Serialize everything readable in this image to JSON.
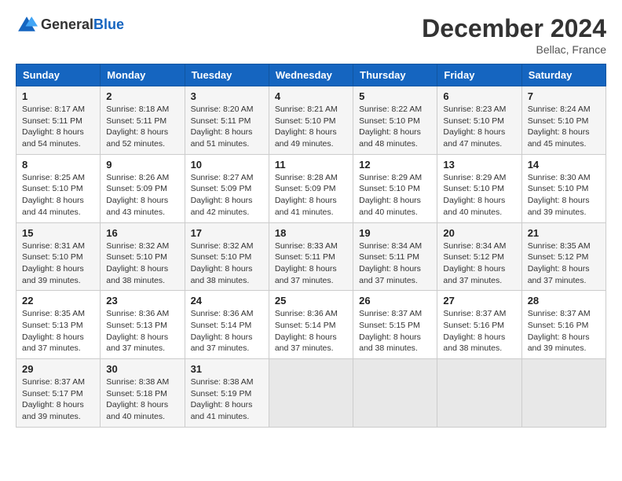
{
  "header": {
    "logo_general": "General",
    "logo_blue": "Blue",
    "title": "December 2024",
    "location": "Bellac, France"
  },
  "days_of_week": [
    "Sunday",
    "Monday",
    "Tuesday",
    "Wednesday",
    "Thursday",
    "Friday",
    "Saturday"
  ],
  "weeks": [
    [
      {
        "day": 1,
        "sunrise": "8:17 AM",
        "sunset": "5:11 PM",
        "daylight": "8 hours and 54 minutes."
      },
      {
        "day": 2,
        "sunrise": "8:18 AM",
        "sunset": "5:11 PM",
        "daylight": "8 hours and 52 minutes."
      },
      {
        "day": 3,
        "sunrise": "8:20 AM",
        "sunset": "5:11 PM",
        "daylight": "8 hours and 51 minutes."
      },
      {
        "day": 4,
        "sunrise": "8:21 AM",
        "sunset": "5:10 PM",
        "daylight": "8 hours and 49 minutes."
      },
      {
        "day": 5,
        "sunrise": "8:22 AM",
        "sunset": "5:10 PM",
        "daylight": "8 hours and 48 minutes."
      },
      {
        "day": 6,
        "sunrise": "8:23 AM",
        "sunset": "5:10 PM",
        "daylight": "8 hours and 47 minutes."
      },
      {
        "day": 7,
        "sunrise": "8:24 AM",
        "sunset": "5:10 PM",
        "daylight": "8 hours and 45 minutes."
      }
    ],
    [
      {
        "day": 8,
        "sunrise": "8:25 AM",
        "sunset": "5:10 PM",
        "daylight": "8 hours and 44 minutes."
      },
      {
        "day": 9,
        "sunrise": "8:26 AM",
        "sunset": "5:09 PM",
        "daylight": "8 hours and 43 minutes."
      },
      {
        "day": 10,
        "sunrise": "8:27 AM",
        "sunset": "5:09 PM",
        "daylight": "8 hours and 42 minutes."
      },
      {
        "day": 11,
        "sunrise": "8:28 AM",
        "sunset": "5:09 PM",
        "daylight": "8 hours and 41 minutes."
      },
      {
        "day": 12,
        "sunrise": "8:29 AM",
        "sunset": "5:10 PM",
        "daylight": "8 hours and 40 minutes."
      },
      {
        "day": 13,
        "sunrise": "8:29 AM",
        "sunset": "5:10 PM",
        "daylight": "8 hours and 40 minutes."
      },
      {
        "day": 14,
        "sunrise": "8:30 AM",
        "sunset": "5:10 PM",
        "daylight": "8 hours and 39 minutes."
      }
    ],
    [
      {
        "day": 15,
        "sunrise": "8:31 AM",
        "sunset": "5:10 PM",
        "daylight": "8 hours and 39 minutes."
      },
      {
        "day": 16,
        "sunrise": "8:32 AM",
        "sunset": "5:10 PM",
        "daylight": "8 hours and 38 minutes."
      },
      {
        "day": 17,
        "sunrise": "8:32 AM",
        "sunset": "5:10 PM",
        "daylight": "8 hours and 38 minutes."
      },
      {
        "day": 18,
        "sunrise": "8:33 AM",
        "sunset": "5:11 PM",
        "daylight": "8 hours and 37 minutes."
      },
      {
        "day": 19,
        "sunrise": "8:34 AM",
        "sunset": "5:11 PM",
        "daylight": "8 hours and 37 minutes."
      },
      {
        "day": 20,
        "sunrise": "8:34 AM",
        "sunset": "5:12 PM",
        "daylight": "8 hours and 37 minutes."
      },
      {
        "day": 21,
        "sunrise": "8:35 AM",
        "sunset": "5:12 PM",
        "daylight": "8 hours and 37 minutes."
      }
    ],
    [
      {
        "day": 22,
        "sunrise": "8:35 AM",
        "sunset": "5:13 PM",
        "daylight": "8 hours and 37 minutes."
      },
      {
        "day": 23,
        "sunrise": "8:36 AM",
        "sunset": "5:13 PM",
        "daylight": "8 hours and 37 minutes."
      },
      {
        "day": 24,
        "sunrise": "8:36 AM",
        "sunset": "5:14 PM",
        "daylight": "8 hours and 37 minutes."
      },
      {
        "day": 25,
        "sunrise": "8:36 AM",
        "sunset": "5:14 PM",
        "daylight": "8 hours and 37 minutes."
      },
      {
        "day": 26,
        "sunrise": "8:37 AM",
        "sunset": "5:15 PM",
        "daylight": "8 hours and 38 minutes."
      },
      {
        "day": 27,
        "sunrise": "8:37 AM",
        "sunset": "5:16 PM",
        "daylight": "8 hours and 38 minutes."
      },
      {
        "day": 28,
        "sunrise": "8:37 AM",
        "sunset": "5:16 PM",
        "daylight": "8 hours and 39 minutes."
      }
    ],
    [
      {
        "day": 29,
        "sunrise": "8:37 AM",
        "sunset": "5:17 PM",
        "daylight": "8 hours and 39 minutes."
      },
      {
        "day": 30,
        "sunrise": "8:38 AM",
        "sunset": "5:18 PM",
        "daylight": "8 hours and 40 minutes."
      },
      {
        "day": 31,
        "sunrise": "8:38 AM",
        "sunset": "5:19 PM",
        "daylight": "8 hours and 41 minutes."
      },
      null,
      null,
      null,
      null
    ]
  ]
}
